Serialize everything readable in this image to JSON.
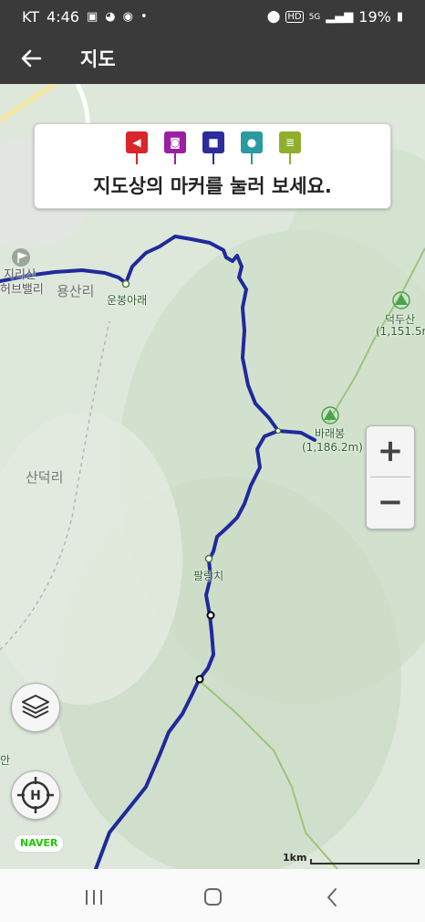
{
  "status_bar": {
    "carrier": "KT",
    "time": "4:46",
    "battery": "19%",
    "icons_left": [
      "gallery-icon",
      "chat-icon",
      "sync-icon",
      "dot-icon"
    ],
    "icons_right": [
      "location-icon",
      "hd-icon",
      "5g-icon",
      "signal-icon",
      "battery-icon"
    ]
  },
  "app_bar": {
    "title": "지도",
    "back_icon": "arrow-left-icon"
  },
  "banner": {
    "message": "지도상의 마커를 눌러 보세요.",
    "markers": [
      {
        "name": "flag-marker",
        "icon": "flag-icon",
        "color": "#d9262a"
      },
      {
        "name": "photo-marker",
        "icon": "camera-icon",
        "color": "#9b1fa3"
      },
      {
        "name": "video-marker",
        "icon": "video-icon",
        "color": "#2c2c9c"
      },
      {
        "name": "audio-marker",
        "icon": "microphone-icon",
        "color": "#2a9aa0"
      },
      {
        "name": "note-marker",
        "icon": "note-icon",
        "color": "#8fae2c"
      }
    ]
  },
  "map": {
    "labels": {
      "jirisan": "지리산",
      "herbvalley": "허브밸리",
      "yongsanri": "용산리",
      "unbong": "운봉아래",
      "deokdusan_name": "덕두산",
      "deokdusan_elev": "(1,151.5m",
      "baraebong_name": "바래봉",
      "baraebong_elev": "(1,186.2m)",
      "sandeokri": "산덕리",
      "palrangchi": "팔랑치",
      "edge_label": "안"
    },
    "route_color": "#1f2a9c",
    "scale_label": "1km",
    "brand": "NAVER"
  },
  "controls": {
    "zoom_in": "+",
    "zoom_out": "−",
    "layers_icon": "layers-icon",
    "locate_icon": "hiking-locate-icon"
  },
  "nav_bar": {
    "recent_icon": "recent-apps-icon",
    "home_icon": "home-icon",
    "back_icon": "back-icon"
  }
}
